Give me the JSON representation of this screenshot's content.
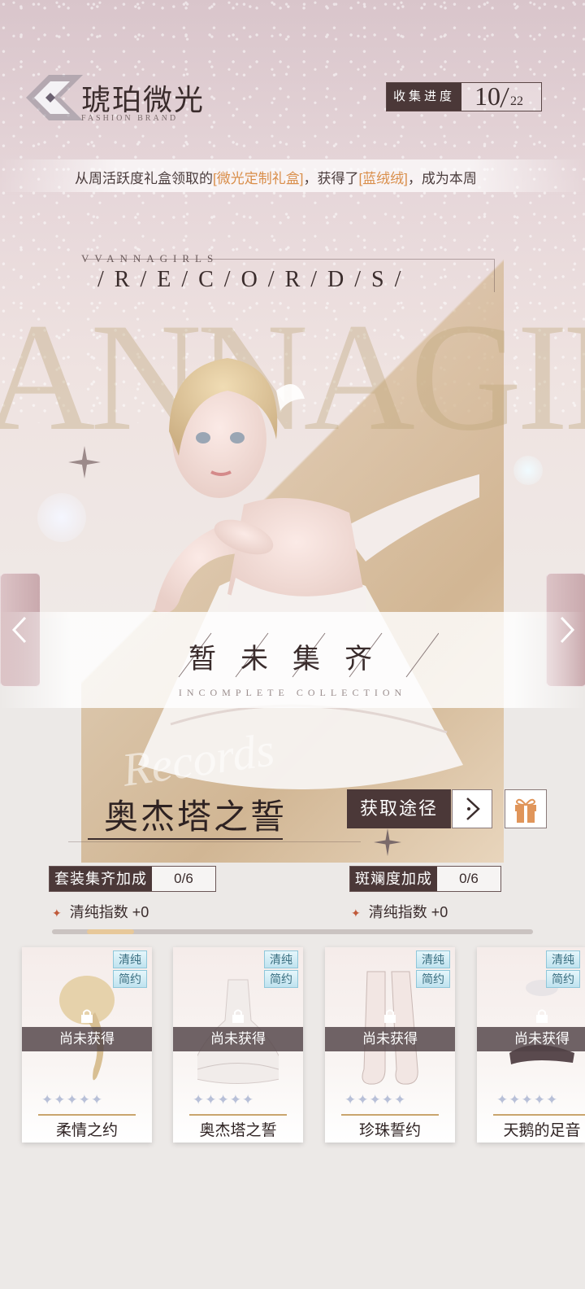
{
  "header": {
    "title": "琥珀微光",
    "subtitle": "FASHION BRAND",
    "progress_label": "收集进度",
    "progress_current": "10",
    "progress_total": "22"
  },
  "ticker": {
    "prefix": "从周活跃度礼盒领取的",
    "item1": "[微光定制礼盒]",
    "middle": "，获得了",
    "item2": "[蓝绒绒]",
    "suffix": "，成为本周"
  },
  "banner": {
    "records_small": "VVANNAGIRLS",
    "records": "/ R / E / C / O / R / D / S /",
    "background_text": "ANNAGIRLS"
  },
  "status_band": {
    "title": "暂未集齐",
    "subtitle": "INCOMPLETE    COLLECTION"
  },
  "set": {
    "script_text": "Records",
    "name": "奥杰塔之誓",
    "obtain_label": "获取途径"
  },
  "bonuses": [
    {
      "label": "套装集齐加成",
      "value": "0/6",
      "stat": "清纯指数",
      "stat_value": "+0"
    },
    {
      "label": "斑斓度加成",
      "value": "0/6",
      "stat": "清纯指数",
      "stat_value": "+0"
    }
  ],
  "scroll": {
    "position": 0.08
  },
  "items": [
    {
      "name": "柔情之约",
      "tags": [
        "清纯",
        "简约"
      ],
      "status": "尚未获得",
      "stars": "✦✦✦✦✦",
      "icon": "hair-icon"
    },
    {
      "name": "奥杰塔之誓",
      "tags": [
        "清纯",
        "简约"
      ],
      "status": "尚未获得",
      "stars": "✦✦✦✦✦",
      "icon": "dress-icon"
    },
    {
      "name": "珍珠誓约",
      "tags": [
        "清纯",
        "简约"
      ],
      "status": "尚未获得",
      "stars": "✦✦✦✦✦",
      "icon": "stockings-icon"
    },
    {
      "name": "天鹅的足音",
      "tags": [
        "清纯",
        "简约"
      ],
      "status": "尚未获得",
      "stars": "✦✦✦✦✦",
      "icon": "shoes-icon"
    }
  ],
  "colors": {
    "accent_dark": "#4b3838",
    "highlight": "#d98e4a",
    "tag_blue": "#bfe3ef",
    "gold": "#c9a56e"
  }
}
